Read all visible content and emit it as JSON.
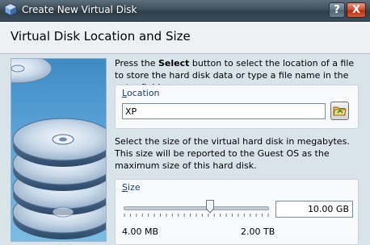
{
  "window": {
    "title": "Create New Virtual Disk",
    "help_label": "?",
    "close_label": "X"
  },
  "header": {
    "title": "Virtual Disk Location and Size"
  },
  "location": {
    "desc_pre": "Press the ",
    "desc_bold": "Select",
    "desc_post": " button to select the location of a file to store the hard disk data or type a file name in the entry field.",
    "label_underlined": "L",
    "label_rest": "ocation",
    "value": "XP",
    "browse_icon": "folder-icon"
  },
  "size": {
    "desc": "Select the size of the virtual hard disk in megabytes. This size will be reported to the Guest OS as the maximum size of this hard disk.",
    "label_underlined": "S",
    "label_rest": "ize",
    "value": "10.00 GB",
    "slider_fraction": 0.6,
    "min_label": "4.00 MB",
    "max_label": "2.00 TB"
  },
  "colors": {
    "title_bar": "#3e4f5c",
    "close_button": "#cf4a2d",
    "group_label": "#1b3f6f"
  }
}
